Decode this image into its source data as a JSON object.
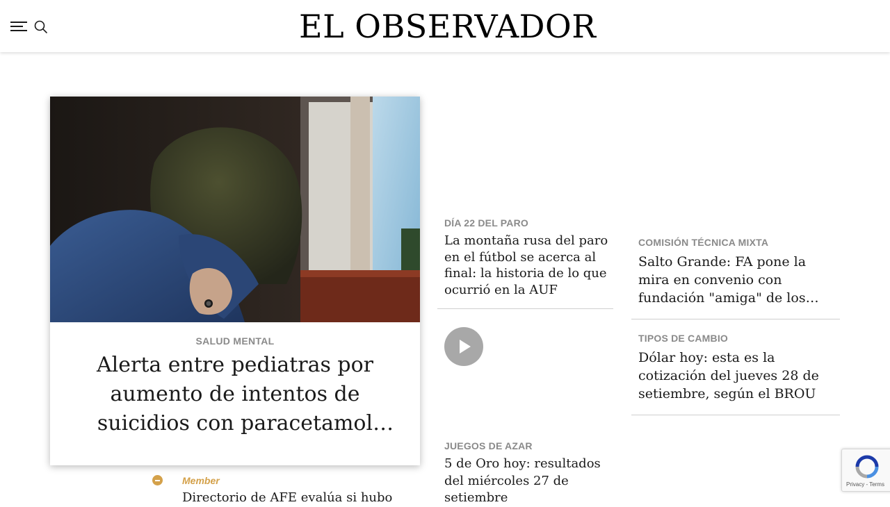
{
  "header": {
    "logo": "EL OBSERVADOR",
    "menu_icon": "hamburger-menu-icon",
    "search_icon": "search-icon"
  },
  "hero": {
    "kicker": "SALUD MENTAL",
    "title": "Alerta entre pediatras por aumento de intentos de suicidios con paracetamol y…",
    "image": "hooded-person-by-window-photo"
  },
  "col2": {
    "article1": {
      "kicker": "DÍA 22 DEL PARO",
      "title": "La montaña rusa del paro en el fútbol se acerca al final: la historia de lo que ocurrió en la AUF"
    },
    "video_icon": "play-icon",
    "article2": {
      "kicker": "JUEGOS DE AZAR",
      "title": "5 de Oro hoy: resultados del miércoles 27 de setiembre"
    }
  },
  "col3": {
    "article1": {
      "kicker": "COMISIÓN TÉCNICA MIXTA",
      "title": "Salto Grande: FA pone la mira en convenio con fundación \"amiga\" de los…"
    },
    "article2": {
      "kicker": "TIPOS DE CAMBIO",
      "title": "Dólar hoy: esta es la cotización del jueves 28 de setiembre, según el BROU"
    }
  },
  "member": {
    "label": "Member",
    "title": "Directorio de AFE evalúa si hubo",
    "icon": "member-badge-icon"
  },
  "recaptcha": {
    "terms": "Privacy - Terms",
    "icon": "recaptcha-icon"
  },
  "colors": {
    "kicker": "#8a8a8a",
    "member_accent": "#d4a14a",
    "play_button": "#a8a8a8"
  }
}
